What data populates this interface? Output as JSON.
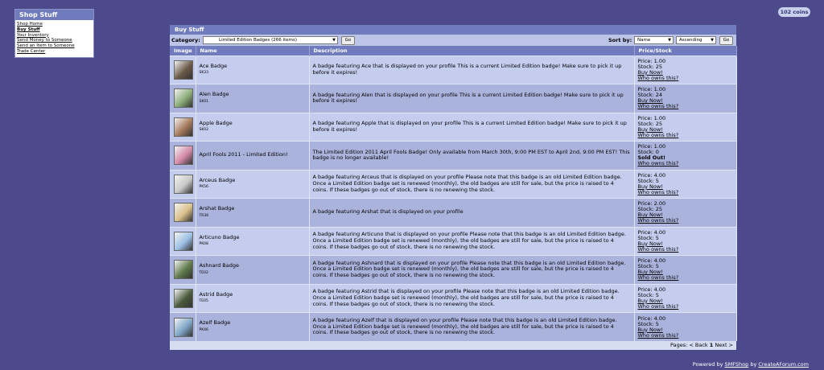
{
  "menu": {
    "title": "Shop Stuff",
    "items": [
      {
        "label": "Shop Home",
        "bold": false
      },
      {
        "label": "Buy Stuff",
        "bold": true
      },
      {
        "label": "Your Inventory",
        "bold": false
      },
      {
        "label": "Send Money to Someone",
        "bold": false
      },
      {
        "label": "Send an Item to Someone",
        "bold": false
      },
      {
        "label": "Trade Center",
        "bold": false
      }
    ]
  },
  "coins": "102 coins",
  "panel": {
    "title": "Buy Stuff",
    "category_label": "Category:",
    "category_value": "Limited Edition Badges (266 items)",
    "go_label": "Go",
    "sortby_label": "Sort by:",
    "sort_field": "Name",
    "sort_order": "Ascending"
  },
  "columns": [
    "Image",
    "Name",
    "Description",
    "Price/Stock"
  ],
  "rows": [
    {
      "name": "Ace Badge",
      "code": "SK33",
      "desc": "A badge featuring Ace that is displayed on your profile This is a current Limited Edition badge! Make sure to pick it up before it expires!",
      "price": "Price: 1.00",
      "stock": "Stock: 25",
      "status": "Buy Now!",
      "sold_out": false,
      "who": "Who owns this?",
      "thumb": "#6b5a48"
    },
    {
      "name": "Alen Badge",
      "code": "SK01",
      "desc": "A badge featuring Alen that is displayed on your profile This is a current Limited Edition badge! Make sure to pick it up before it expires!",
      "price": "Price: 1.00",
      "stock": "Stock: 24",
      "status": "Buy Now!",
      "sold_out": false,
      "who": "Who owns this?",
      "thumb": "#8cae7a"
    },
    {
      "name": "Apple Badge",
      "code": "SK02",
      "desc": "A badge featuring Apple that is displayed on your profile This is a current Limited Edition badge! Make sure to pick it up before it expires!",
      "price": "Price: 1.00",
      "stock": "Stock: 25",
      "status": "Buy Now!",
      "sold_out": false,
      "who": "Who owns this?",
      "thumb": "#a67a5c"
    },
    {
      "name": "April Fools 2011 - Limited Edition!",
      "code": "",
      "desc": "The Limited Edition 2011 April Fools Badge! Only available from March 30th, 9:00 PM EST to April 2nd, 9:00 PM EST! This badge is no longer available!",
      "price": "Price: 1.00",
      "stock": "Stock: 0",
      "status": "Sold Out!",
      "sold_out": true,
      "who": "Who owns this?",
      "thumb": "#d48aa8"
    },
    {
      "name": "Arceus Badge",
      "code": "PK56",
      "desc": "A badge featuring Arceus that is displayed on your profile Please note that this badge is an old Limited Edition badge. Once a Limited Edition badge set is renewed (monthly), the old badges are still for sale, but the price is raised to 4 coins. If these badges go out of stock, there is no renewing the stock.",
      "price": "Price: 4.00",
      "stock": "Stock: 5",
      "status": "Buy Now!",
      "sold_out": false,
      "who": "Who owns this?",
      "thumb": "#c9c9c9"
    },
    {
      "name": "Arshat Badge",
      "code": "TR36",
      "desc": "A badge featuring Arshat that is displayed on your profile",
      "price": "Price: 2.00",
      "stock": "Stock: 25",
      "status": "Buy Now!",
      "sold_out": false,
      "who": "Who owns this?",
      "thumb": "#d8c08a"
    },
    {
      "name": "Articuno Badge",
      "code": "PK08",
      "desc": "A badge featuring Articuno that is displayed on your profile Please note that this badge is an old Limited Edition badge. Once a Limited Edition badge set is renewed (monthly), the old badges are still for sale, but the price is raised to 4 coins. If these badges go out of stock, there is no renewing the stock.",
      "price": "Price: 4.00",
      "stock": "Stock: 5",
      "status": "Buy Now!",
      "sold_out": false,
      "who": "Who owns this?",
      "thumb": "#9cc0e6"
    },
    {
      "name": "Ashnard Badge",
      "code": "TE02",
      "desc": "A badge featuring Ashnard that is displayed on your profile Please note that this badge is an old Limited Edition badge. Once a Limited Edition badge set is renewed (monthly), the old badges are still for sale, but the price is raised to 4 coins. If these badges go out of stock, there is no renewing the stock.",
      "price": "Price: 4.00",
      "stock": "Stock: 5",
      "status": "Buy Now!",
      "sold_out": false,
      "who": "Who owns this?",
      "thumb": "#5f7a4a"
    },
    {
      "name": "Astrid Badge",
      "code": "TE05",
      "desc": "A badge featuring Astrid that is displayed on your profile Please note that this badge is an old Limited Edition badge. Once a Limited Edition badge set is renewed (monthly), the old badges are still for sale, but the price is raised to 4 coins. If these badges go out of stock, there is no renewing the stock.",
      "price": "Price: 4.00",
      "stock": "Stock: 5",
      "status": "Buy Now!",
      "sold_out": false,
      "who": "Who owns this?",
      "thumb": "#4a5a3c"
    },
    {
      "name": "Azelf Badge",
      "code": "PK46",
      "desc": "A badge featuring Azelf that is displayed on your profile Please note that this badge is an old Limited Edition badge. Once a Limited Edition badge set is renewed (monthly), the old badges are still for sale, but the price is raised to 4 coins. If these badges go out of stock, there is no renewing the stock.",
      "price": "Price: 4.00",
      "stock": "Stock: 5",
      "status": "Buy Now!",
      "sold_out": false,
      "who": "Who owns this?",
      "thumb": "#7fa6c8"
    }
  ],
  "pagination": {
    "prefix": "Pages:",
    "back": "< Back",
    "current": "1",
    "next": "Next >"
  },
  "footer": {
    "prefix": "Powered by",
    "link1": "SMFShop",
    "mid": "by",
    "link2": "CreateAForum.com"
  }
}
